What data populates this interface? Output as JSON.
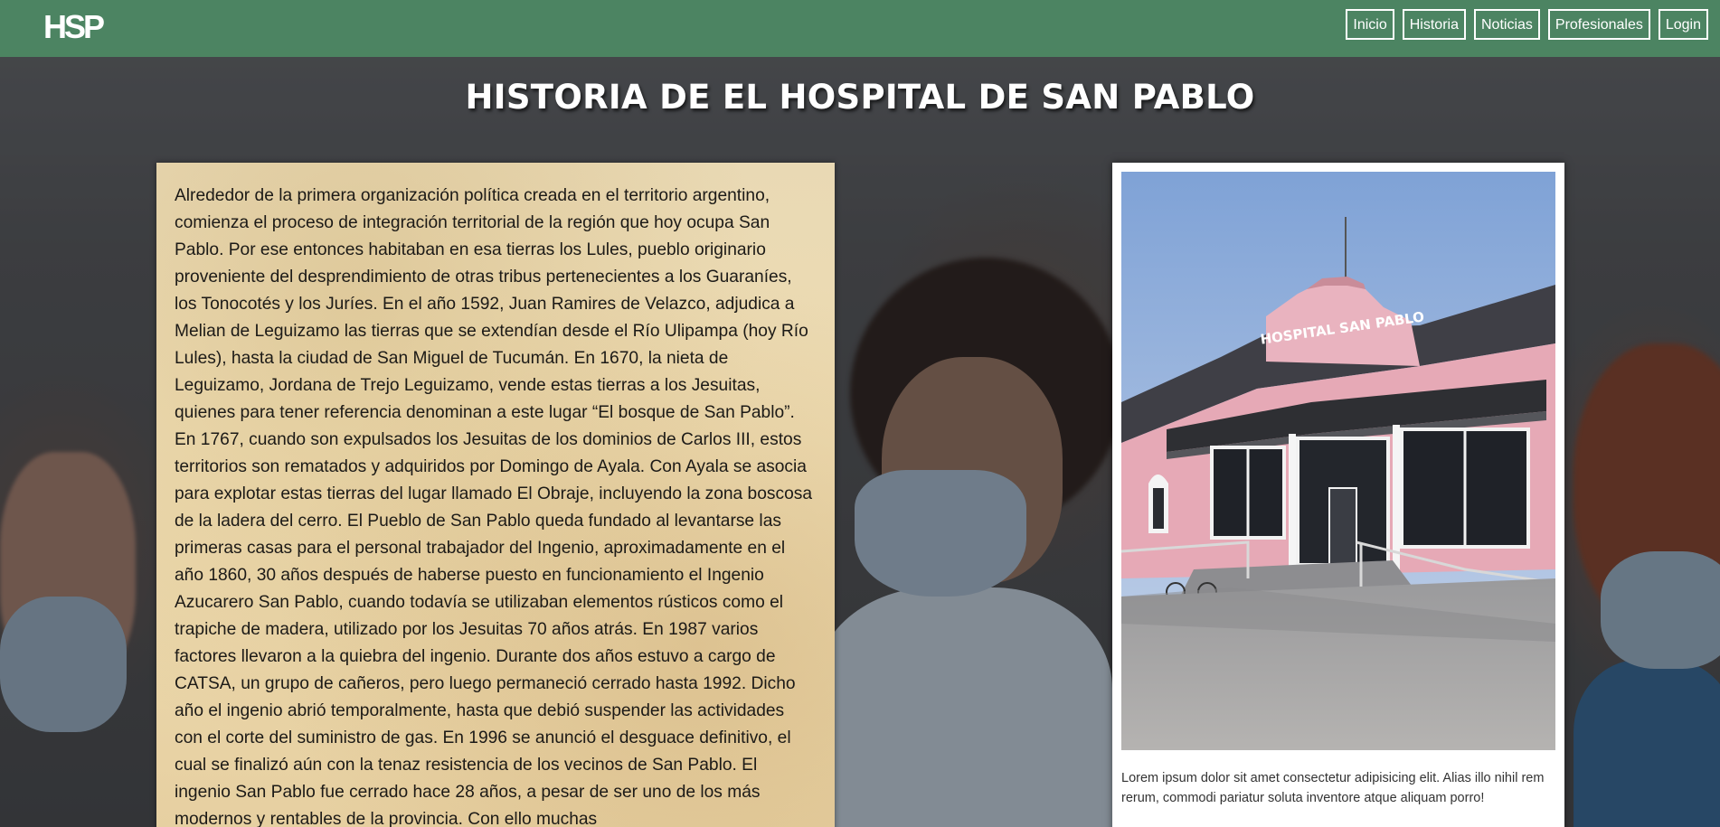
{
  "navbar": {
    "logo_text": "HSP",
    "links": [
      {
        "label": "Inicio"
      },
      {
        "label": "Historia"
      },
      {
        "label": "Noticias"
      },
      {
        "label": "Profesionales"
      },
      {
        "label": "Login"
      }
    ],
    "background_color": "#4d8a64"
  },
  "page": {
    "title": "HISTORIA DE EL HOSPITAL DE SAN PABLO"
  },
  "history": {
    "text": "Alrededor de la primera organización política creada en el territorio argentino, comienza el proceso de integración territorial de la región que hoy ocupa San Pablo. Por ese entonces habitaban en esa tierras los Lules, pueblo originario proveniente del desprendimiento de otras tribus pertenecientes a los Guaraníes, los Tonocotés y los Juríes. En el año 1592, Juan Ramires de Velazco, adjudica a Melian de Leguizamo las tierras que se extendían desde el Río Ulipampa (hoy Río Lules), hasta la ciudad de San Miguel de Tucumán. En 1670, la nieta de Leguizamo, Jordana de Trejo Leguizamo, vende estas tierras a los Jesuitas, quienes para tener referencia denominan a este lugar “El bosque de San Pablo”. En 1767, cuando son expulsados los Jesuitas de los dominios de Carlos III, estos territorios son rematados y adquiridos por Domingo de Ayala. Con Ayala se asocia para explotar estas tierras del lugar llamado El Obraje, incluyendo la zona boscosa de la ladera del cerro. El Pueblo de San Pablo queda fundado al levantarse las primeras casas para el personal trabajador del Ingenio, aproximadamente en el año 1860, 30 años después de haberse puesto en funcionamiento el Ingenio Azucarero San Pablo, cuando todavía se utilizaban elementos rústicos como el trapiche de madera, utilizado por los Jesuitas 70 años atrás. En 1987 varios factores llevaron a la quiebra del ingenio. Durante dos años estuvo a cargo de CATSA, un grupo de cañeros, pero luego permaneció cerrado hasta 1992. Dicho año el ingenio abrió temporalmente, hasta que debió suspender las actividades con el corte del suministro de gas. En 1996 se anunció el desguace definitivo, el cual se finalizó aún con la tenaz resistencia de los vecinos de San Pablo. El ingenio San Pablo fue cerrado hace 28 años, a pesar de ser uno de los más modernos y rentables de la provincia. Con ello muchas"
  },
  "photo": {
    "building_sign": "HOSPITAL SAN PABLO",
    "caption": "Lorem ipsum dolor sit amet consectetur adipisicing elit. Alias illo nihil rem rerum, commodi pariatur soluta inventore atque aliquam porro!"
  }
}
